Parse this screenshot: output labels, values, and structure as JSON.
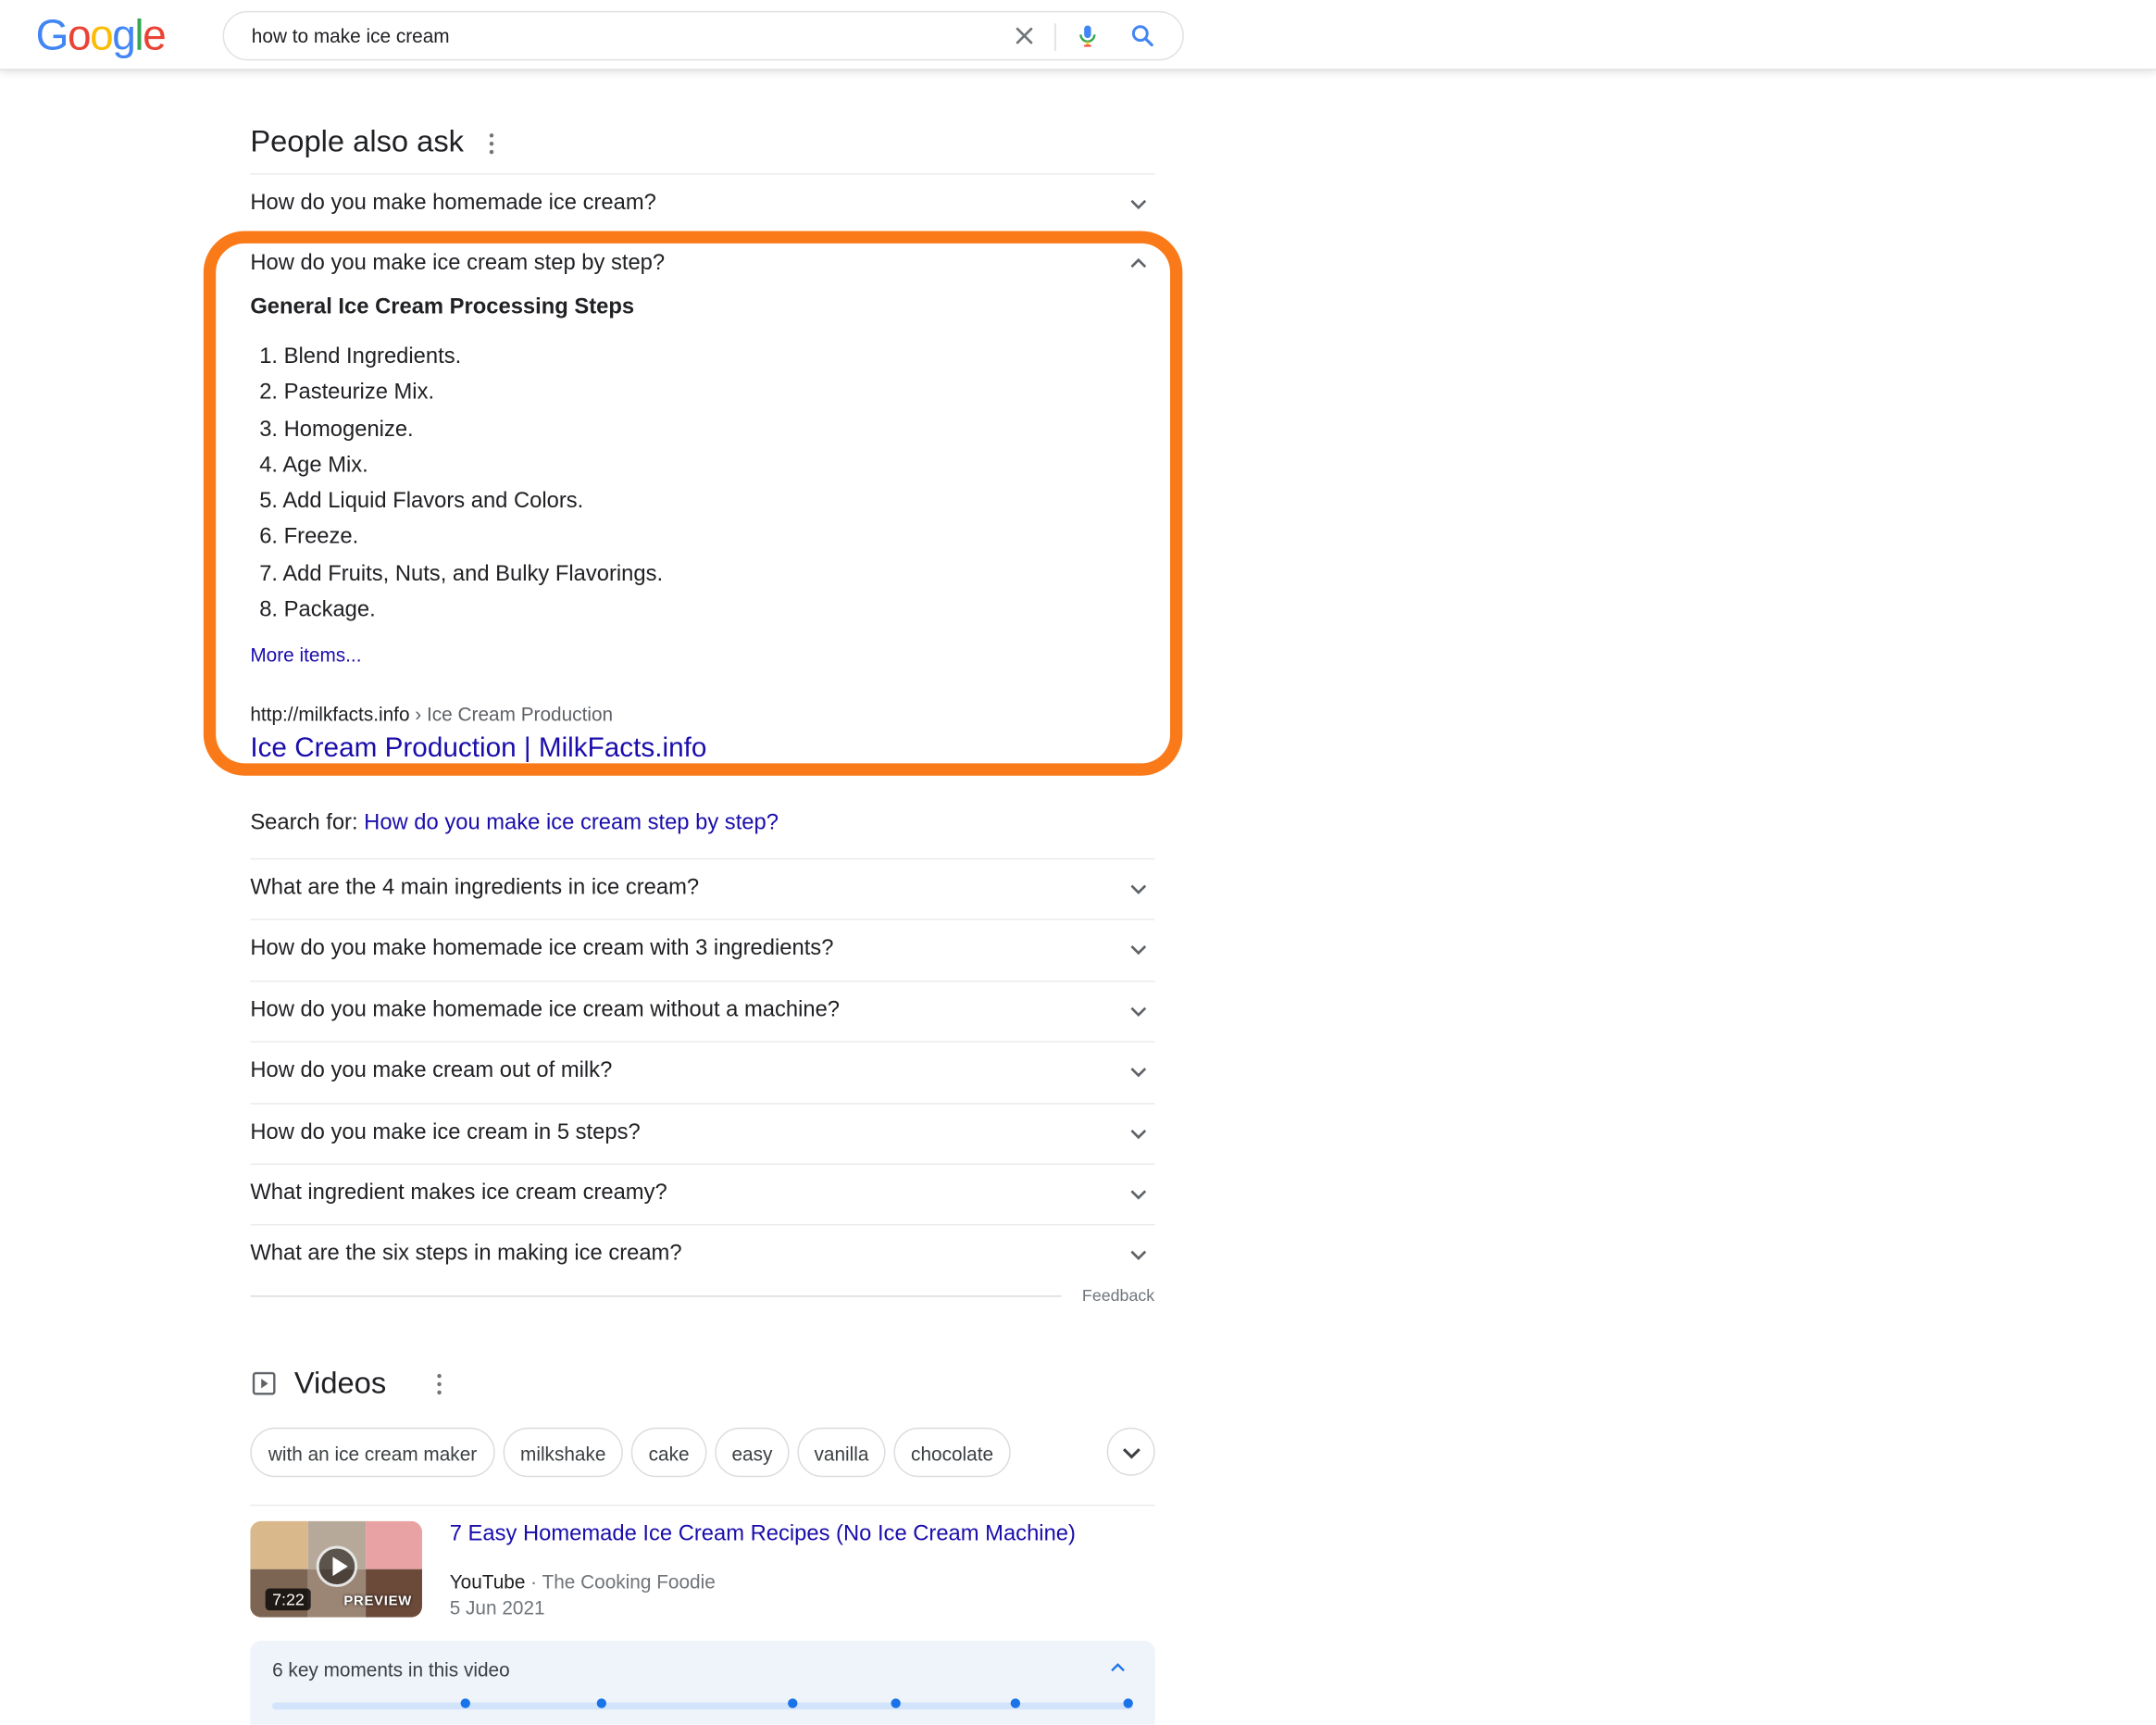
{
  "header": {
    "logo_letters": [
      {
        "ch": "G",
        "color": "#4285f4"
      },
      {
        "ch": "o",
        "color": "#ea4335"
      },
      {
        "ch": "o",
        "color": "#fbbc05"
      },
      {
        "ch": "g",
        "color": "#4285f4"
      },
      {
        "ch": "l",
        "color": "#34a853"
      },
      {
        "ch": "e",
        "color": "#ea4335"
      }
    ],
    "search_value": "how to make ice cream",
    "icons": [
      "clear-icon",
      "mic-icon",
      "search-icon"
    ]
  },
  "paa": {
    "title": "People also ask",
    "first_question": "How do you make homemade ice cream?",
    "expanded": {
      "question": "How do you make ice cream step by step?",
      "answer_title": "General Ice Cream Processing Steps",
      "steps": [
        "Blend Ingredients.",
        "Pasteurize Mix.",
        "Homogenize.",
        "Age Mix.",
        "Add Liquid Flavors and Colors.",
        "Freeze.",
        "Add Fruits, Nuts, and Bulky Flavorings.",
        "Package."
      ],
      "step_numbers": [
        "1.",
        "2.",
        "3.",
        "4.",
        "5.",
        "6.",
        "7.",
        "8."
      ],
      "more_items": "More items...",
      "cite_domain": "http://milkfacts.info",
      "cite_crumb": " › Ice Cream Production",
      "result_title": "Ice Cream Production | MilkFacts.info",
      "search_for_label": "Search for: ",
      "search_for_query": "How do you make ice cream step by step?",
      "highlight_color": "#fa7a19"
    },
    "questions": [
      "What are the 4 main ingredients in ice cream?",
      "How do you make homemade ice cream with 3 ingredients?",
      "How do you make homemade ice cream without a machine?",
      "How do you make cream out of milk?",
      "How do you make ice cream in 5 steps?",
      "What ingredient makes ice cream creamy?",
      "What are the six steps in making ice cream?"
    ],
    "feedback": "Feedback"
  },
  "videos": {
    "title": "Videos",
    "chips": [
      "with an ice cream maker",
      "milkshake",
      "cake",
      "easy",
      "vanilla",
      "chocolate"
    ],
    "result": {
      "duration": "7:22",
      "preview": "PREVIEW",
      "title": "7 Easy Homemade Ice Cream Recipes (No Ice Cream Machine)",
      "source": "YouTube",
      "channel": " · The Cooking Foodie",
      "date": "5 Jun 2021"
    },
    "key_moments": {
      "label": "6 key moments in this video",
      "count": 6
    }
  },
  "colors": {
    "link": "#1a0dab",
    "text": "#202124",
    "muted": "#70757a",
    "accent_blue": "#1a73e8"
  }
}
